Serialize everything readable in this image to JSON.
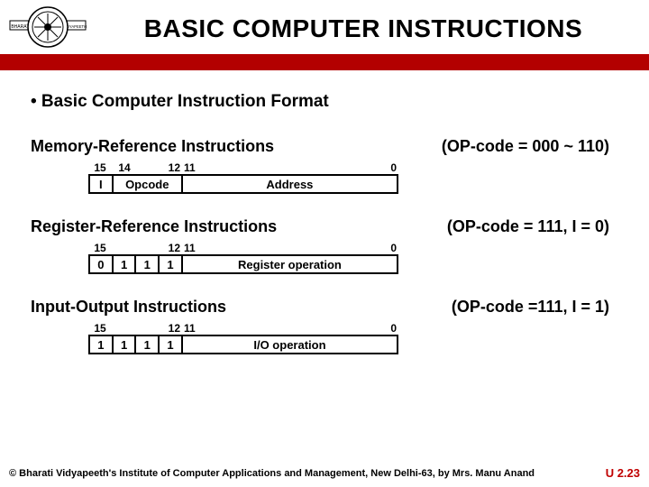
{
  "header": {
    "title": "BASIC COMPUTER  INSTRUCTIONS",
    "logo_top": "BHARATI",
    "logo_bottom": "VIDYAPEETH"
  },
  "bullet": "• Basic Computer Instruction Format",
  "sec1": {
    "title": "Memory-Reference Instructions",
    "op": "(OP-code = 000 ~ 110)",
    "bits": {
      "b15": "15",
      "b14": "14",
      "b12": "12",
      "b11": "11",
      "b0": "0"
    },
    "cells": {
      "i": "I",
      "opcode": "Opcode",
      "addr": "Address"
    }
  },
  "sec2": {
    "title": "Register-Reference Instructions",
    "op": "(OP-code = 111, I = 0)",
    "bits": {
      "b15": "15",
      "b12": "12",
      "b11": "11",
      "b0": "0"
    },
    "cells": {
      "c0": "0",
      "c1": "1",
      "c2": "1",
      "c3": "1",
      "body": "Register operation"
    }
  },
  "sec3": {
    "title": "Input-Output Instructions",
    "op": "(OP-code =111, I = 1)",
    "bits": {
      "b15": "15",
      "b12": "12",
      "b11": "11",
      "b0": "0"
    },
    "cells": {
      "c0": "1",
      "c1": "1",
      "c2": "1",
      "c3": "1",
      "body": "I/O operation"
    }
  },
  "footer": {
    "copy": "© Bharati Vidyapeeth's Institute of Computer Applications and Management, New Delhi-63, by Mrs. Manu Anand",
    "page": "U 2.23"
  }
}
